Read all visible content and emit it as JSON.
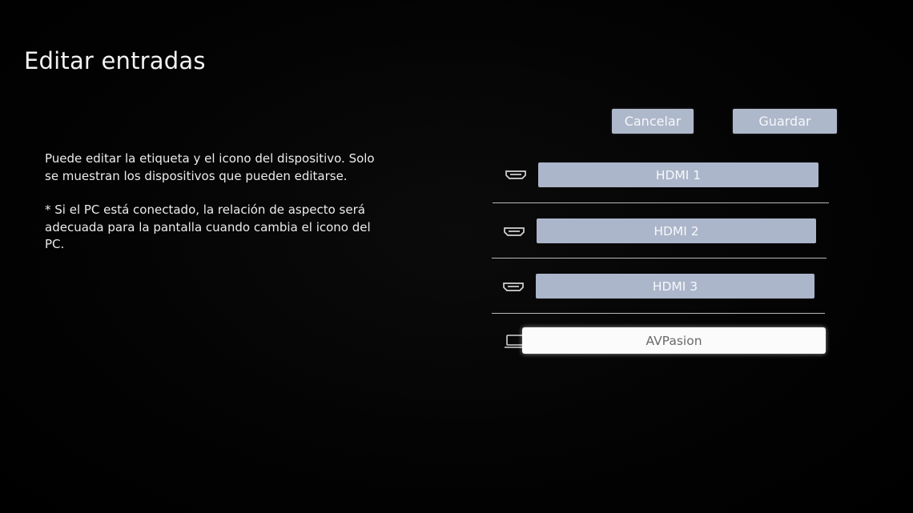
{
  "page": {
    "title": "Editar entradas"
  },
  "description": {
    "line1": "Puede editar la etiqueta y el icono del dispositivo. Solo se muestran los dispositivos que pueden editarse.",
    "line2": "* Si el PC está conectado, la relación de aspecto será adecuada para la pantalla cuando cambia el icono del PC."
  },
  "actions": {
    "cancel_label": "Cancelar",
    "save_label": "Guardar"
  },
  "inputs": [
    {
      "label": "HDMI 1",
      "icon": "hdmi-port-icon",
      "focused": false
    },
    {
      "label": "HDMI 2",
      "icon": "hdmi-port-icon",
      "focused": false
    },
    {
      "label": "HDMI 3",
      "icon": "hdmi-port-icon",
      "focused": false
    },
    {
      "label": "AVPasion",
      "icon": "laptop-pc-icon",
      "focused": true
    }
  ],
  "colors": {
    "background": "#020202",
    "button_fill": "#abb6ca",
    "focused_fill": "#fbfbfb",
    "text": "#ececec"
  }
}
